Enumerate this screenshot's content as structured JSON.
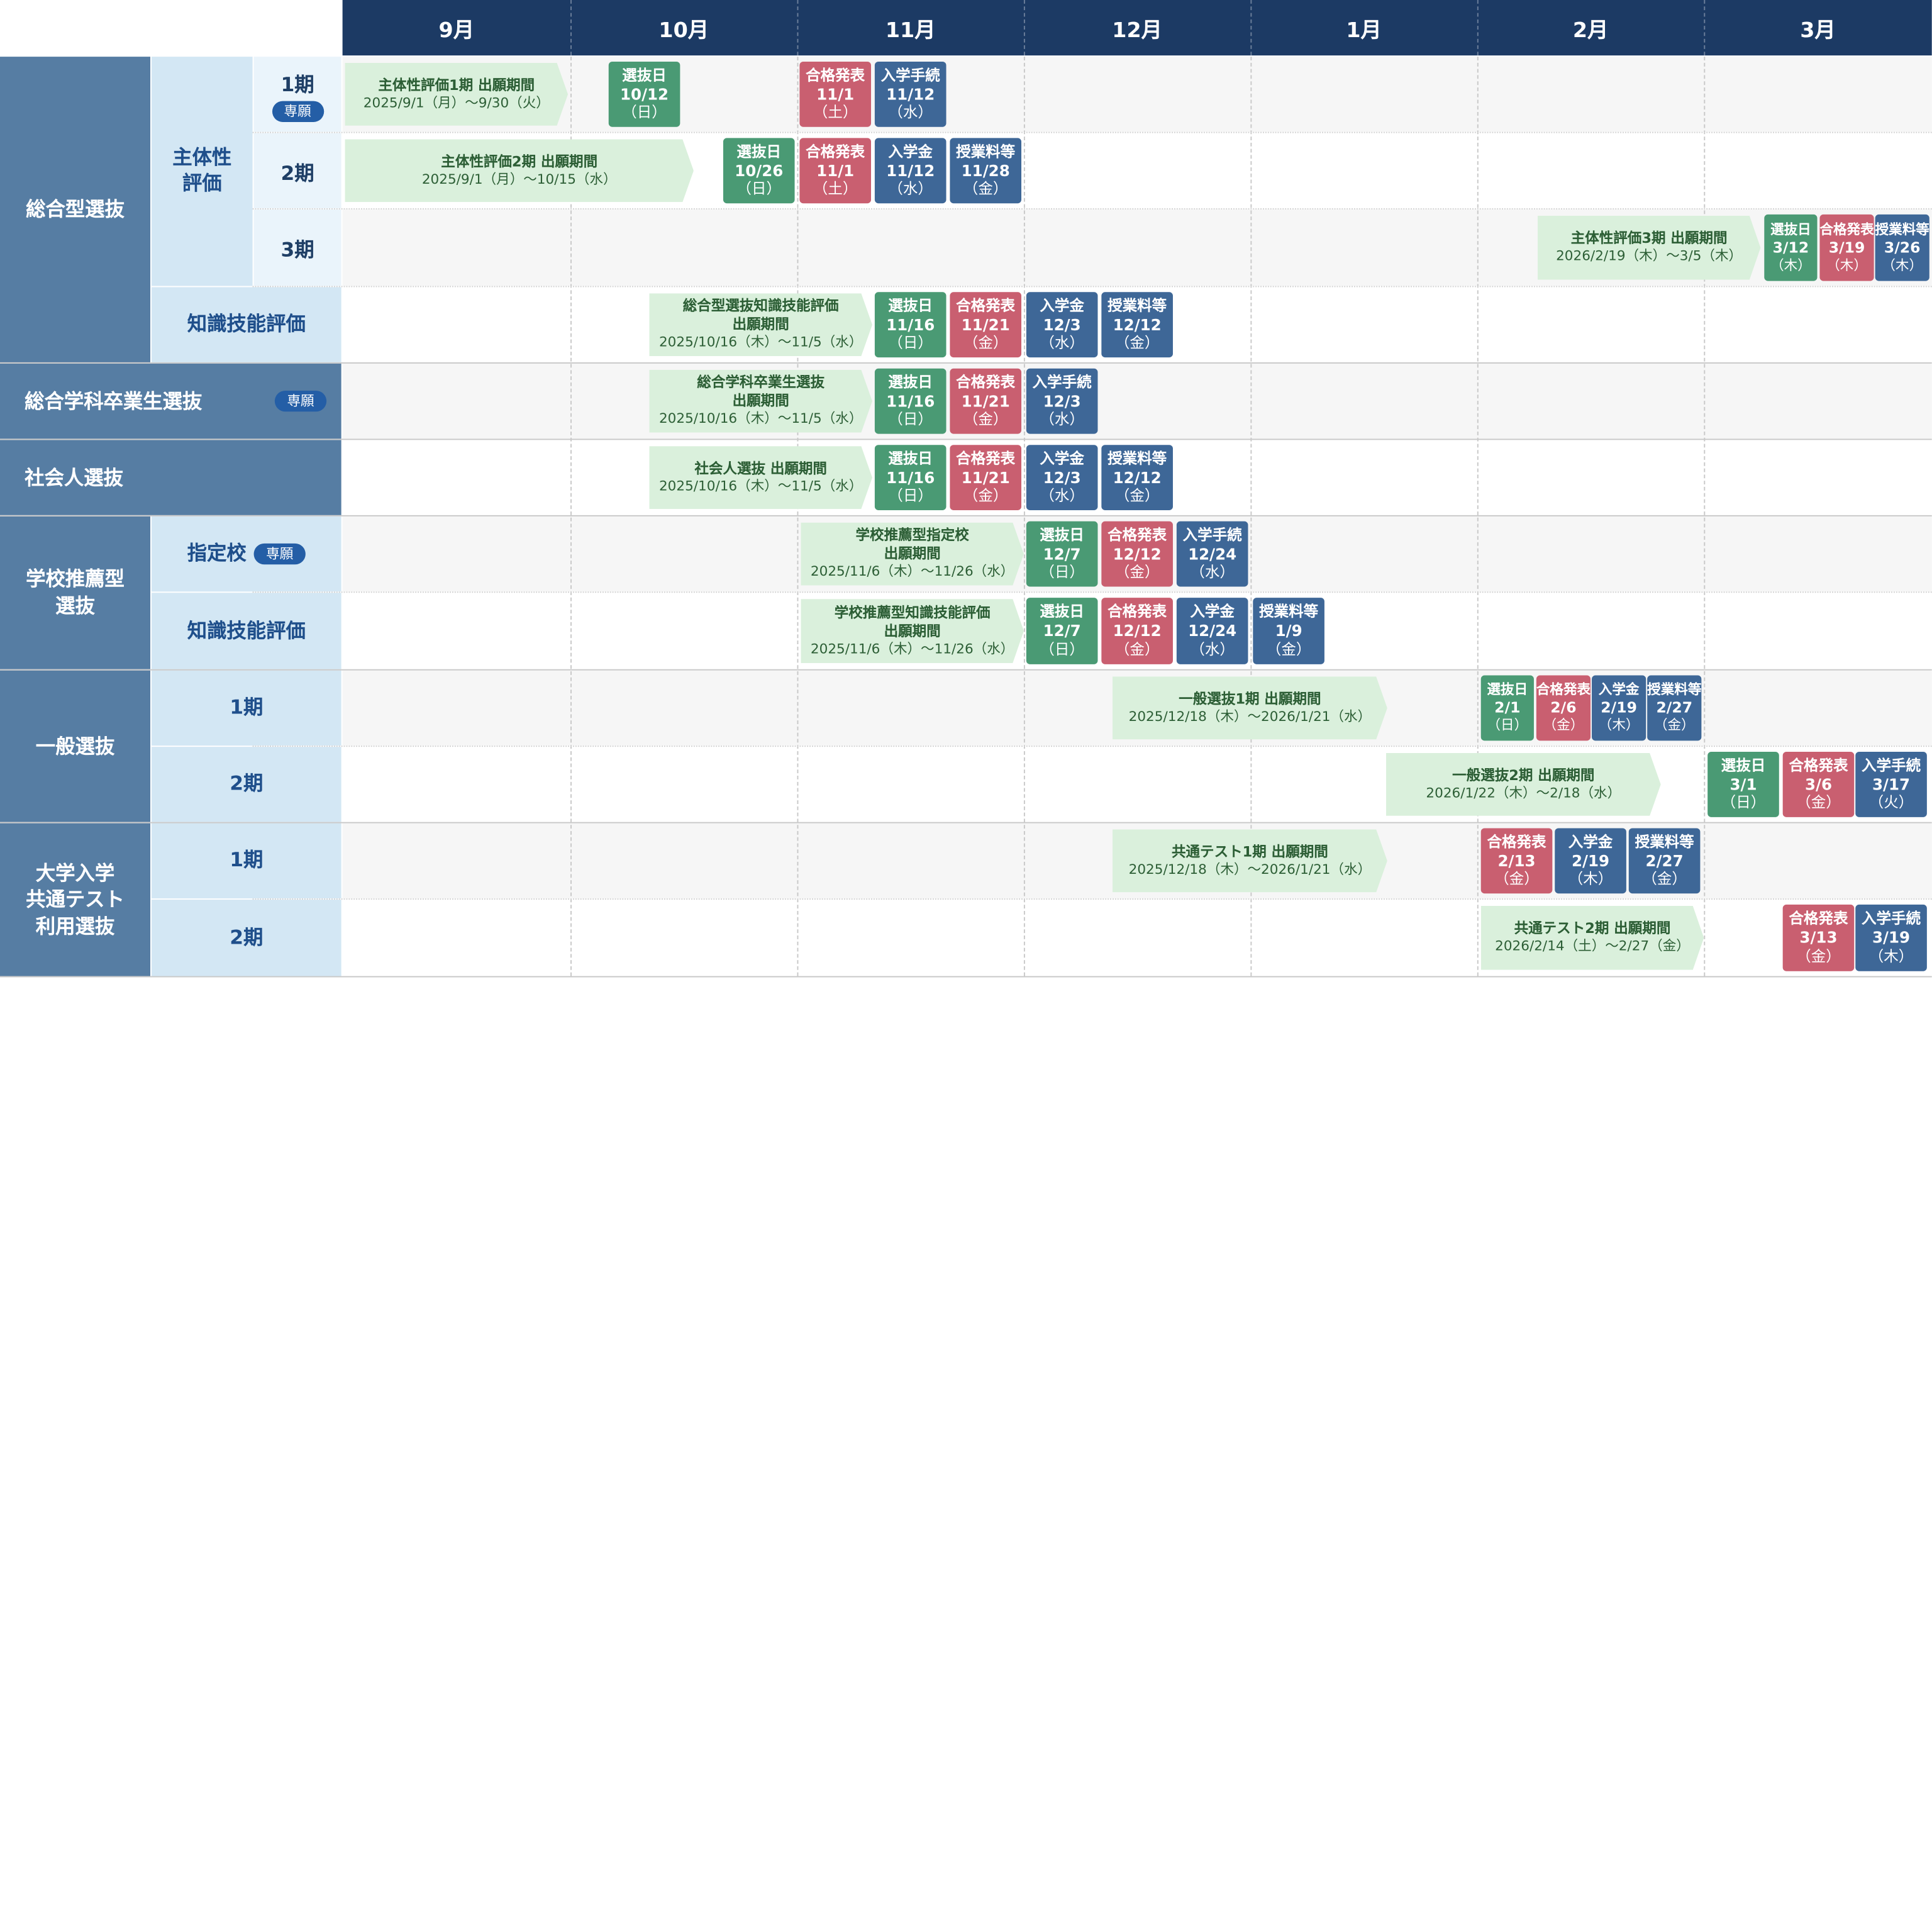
{
  "months": [
    "9月",
    "10月",
    "11月",
    "12月",
    "1月",
    "2月",
    "3月"
  ],
  "categories": {
    "sougou": "総合型選抜",
    "shutaisei": "主体性\n評価",
    "s1": "1期",
    "s2": "2期",
    "s3": "3期",
    "chishiki": "知識技能評価",
    "sougougakka": "総合学科卒業生選抜",
    "shakaijin": "社会人選抜",
    "gakko": "学校推薦型\n選抜",
    "shiteiko": "指定校",
    "gchishiki": "知識技能評価",
    "ippan": "一般選抜",
    "i1": "1期",
    "i2": "2期",
    "kyotsu": "大学入学\n共通テスト\n利用選抜",
    "k1": "1期",
    "k2": "2期",
    "badge": "専願"
  },
  "rows": [
    {
      "name": "主体性評価 1期",
      "period": {
        "title": "主体性評価1期 出願期間",
        "dates": "2025/9/1（月）～9/30（火）"
      },
      "events": [
        {
          "kind": "sel",
          "label": "選抜日",
          "date": "10/12",
          "dow": "（日）"
        },
        {
          "kind": "pas",
          "label": "合格発表",
          "date": "11/1",
          "dow": "（土）"
        },
        {
          "kind": "ent",
          "label": "入学手続",
          "date": "11/12",
          "dow": "（水）"
        }
      ]
    },
    {
      "name": "主体性評価 2期",
      "period": {
        "title": "主体性評価2期 出願期間",
        "dates": "2025/9/1（月）～10/15（水）"
      },
      "events": [
        {
          "kind": "sel",
          "label": "選抜日",
          "date": "10/26",
          "dow": "（日）"
        },
        {
          "kind": "pas",
          "label": "合格発表",
          "date": "11/1",
          "dow": "（土）"
        },
        {
          "kind": "ent",
          "label": "入学金",
          "date": "11/12",
          "dow": "（水）"
        },
        {
          "kind": "ent",
          "label": "授業料等",
          "date": "11/28",
          "dow": "（金）"
        }
      ]
    },
    {
      "name": "主体性評価 3期",
      "period": {
        "title": "主体性評価3期 出願期間",
        "dates": "2026/2/19（木）～3/5（木）"
      },
      "events": [
        {
          "kind": "sel",
          "label": "選抜日",
          "date": "3/12",
          "dow": "（木）"
        },
        {
          "kind": "pas",
          "label": "合格発表",
          "date": "3/19",
          "dow": "（木）"
        },
        {
          "kind": "ent",
          "label": "授業料等",
          "date": "3/26",
          "dow": "（木）"
        }
      ]
    },
    {
      "name": "総合型選抜 知識技能評価",
      "period": {
        "title": "総合型選抜知識技能評価\n出願期間",
        "dates": "2025/10/16（木）～11/5（水）"
      },
      "events": [
        {
          "kind": "sel",
          "label": "選抜日",
          "date": "11/16",
          "dow": "（日）"
        },
        {
          "kind": "pas",
          "label": "合格発表",
          "date": "11/21",
          "dow": "（金）"
        },
        {
          "kind": "ent",
          "label": "入学金",
          "date": "12/3",
          "dow": "（水）"
        },
        {
          "kind": "ent",
          "label": "授業料等",
          "date": "12/12",
          "dow": "（金）"
        }
      ]
    },
    {
      "name": "総合学科卒業生選抜",
      "period": {
        "title": "総合学科卒業生選抜\n出願期間",
        "dates": "2025/10/16（木）～11/5（水）"
      },
      "events": [
        {
          "kind": "sel",
          "label": "選抜日",
          "date": "11/16",
          "dow": "（日）"
        },
        {
          "kind": "pas",
          "label": "合格発表",
          "date": "11/21",
          "dow": "（金）"
        },
        {
          "kind": "ent",
          "label": "入学手続",
          "date": "12/3",
          "dow": "（水）"
        }
      ]
    },
    {
      "name": "社会人選抜",
      "period": {
        "title": "社会人選抜 出願期間",
        "dates": "2025/10/16（木）～11/5（水）"
      },
      "events": [
        {
          "kind": "sel",
          "label": "選抜日",
          "date": "11/16",
          "dow": "（日）"
        },
        {
          "kind": "pas",
          "label": "合格発表",
          "date": "11/21",
          "dow": "（金）"
        },
        {
          "kind": "ent",
          "label": "入学金",
          "date": "12/3",
          "dow": "（水）"
        },
        {
          "kind": "ent",
          "label": "授業料等",
          "date": "12/12",
          "dow": "（金）"
        }
      ]
    },
    {
      "name": "学校推薦型 指定校",
      "period": {
        "title": "学校推薦型指定校\n出願期間",
        "dates": "2025/11/6（木）～11/26（水）"
      },
      "events": [
        {
          "kind": "sel",
          "label": "選抜日",
          "date": "12/7",
          "dow": "（日）"
        },
        {
          "kind": "pas",
          "label": "合格発表",
          "date": "12/12",
          "dow": "（金）"
        },
        {
          "kind": "ent",
          "label": "入学手続",
          "date": "12/24",
          "dow": "（水）"
        }
      ]
    },
    {
      "name": "学校推薦型 知識技能評価",
      "period": {
        "title": "学校推薦型知識技能評価\n出願期間",
        "dates": "2025/11/6（木）～11/26（水）"
      },
      "events": [
        {
          "kind": "sel",
          "label": "選抜日",
          "date": "12/7",
          "dow": "（日）"
        },
        {
          "kind": "pas",
          "label": "合格発表",
          "date": "12/12",
          "dow": "（金）"
        },
        {
          "kind": "ent",
          "label": "入学金",
          "date": "12/24",
          "dow": "（水）"
        },
        {
          "kind": "ent",
          "label": "授業料等",
          "date": "1/9",
          "dow": "（金）"
        }
      ]
    },
    {
      "name": "一般選抜 1期",
      "period": {
        "title": "一般選抜1期 出願期間",
        "dates": "2025/12/18（木）～2026/1/21（水）"
      },
      "events": [
        {
          "kind": "sel",
          "label": "選抜日",
          "date": "2/1",
          "dow": "（日）"
        },
        {
          "kind": "pas",
          "label": "合格発表",
          "date": "2/6",
          "dow": "（金）"
        },
        {
          "kind": "ent",
          "label": "入学金",
          "date": "2/19",
          "dow": "（木）"
        },
        {
          "kind": "ent",
          "label": "授業料等",
          "date": "2/27",
          "dow": "（金）"
        }
      ]
    },
    {
      "name": "一般選抜 2期",
      "period": {
        "title": "一般選抜2期 出願期間",
        "dates": "2026/1/22（木）～2/18（水）"
      },
      "events": [
        {
          "kind": "sel",
          "label": "選抜日",
          "date": "3/1",
          "dow": "（日）"
        },
        {
          "kind": "pas",
          "label": "合格発表",
          "date": "3/6",
          "dow": "（金）"
        },
        {
          "kind": "ent",
          "label": "入学手続",
          "date": "3/17",
          "dow": "（火）"
        }
      ]
    },
    {
      "name": "共通テスト 1期",
      "period": {
        "title": "共通テスト1期 出願期間",
        "dates": "2025/12/18（木）～2026/1/21（水）"
      },
      "events": [
        {
          "kind": "pas",
          "label": "合格発表",
          "date": "2/13",
          "dow": "（金）"
        },
        {
          "kind": "ent",
          "label": "入学金",
          "date": "2/19",
          "dow": "（木）"
        },
        {
          "kind": "ent",
          "label": "授業料等",
          "date": "2/27",
          "dow": "（金）"
        }
      ]
    },
    {
      "name": "共通テスト 2期",
      "period": {
        "title": "共通テスト2期 出願期間",
        "dates": "2026/2/14（土）～2/27（金）"
      },
      "events": [
        {
          "kind": "pas",
          "label": "合格発表",
          "date": "3/13",
          "dow": "（金）"
        },
        {
          "kind": "ent",
          "label": "入学手続",
          "date": "3/19",
          "dow": "（木）"
        }
      ]
    }
  ],
  "colors": {
    "header": "#1c3a64",
    "category": "#567da3",
    "period": "#daf0dc",
    "selection": "#4a9a74",
    "pass": "#c95f70",
    "procedure": "#3e6797"
  }
}
